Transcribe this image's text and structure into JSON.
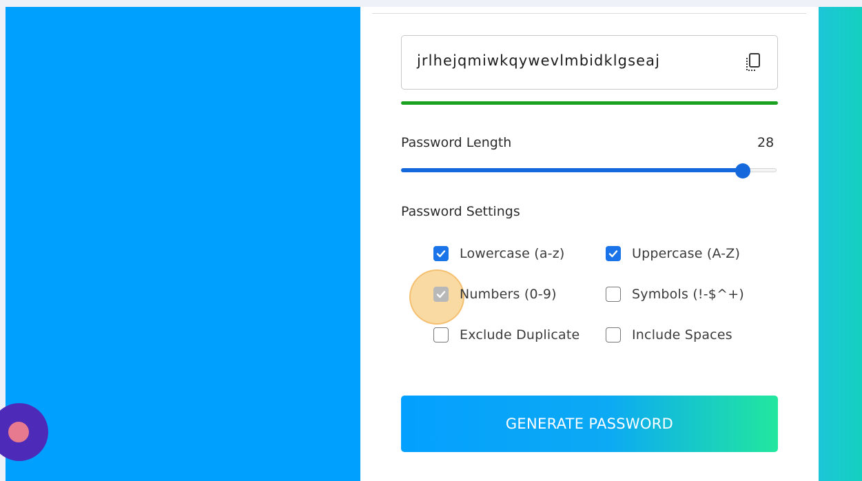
{
  "password_field": {
    "value": "jrlhejqmiwkqywevlmbidklgseaj",
    "copy_icon": "copy-icon"
  },
  "strength": {
    "color": "#19a11f"
  },
  "length": {
    "label": "Password Length",
    "value": "28",
    "slider_level": 0.91
  },
  "settings": {
    "title": "Password Settings",
    "options": [
      {
        "label": "Lowercase (a-z)",
        "checked": true
      },
      {
        "label": "Uppercase (A-Z)",
        "checked": true
      },
      {
        "label": "Numbers (0-9)",
        "checked": true
      },
      {
        "label": "Symbols (!-$^+)",
        "checked": false
      },
      {
        "label": "Exclude Duplicate",
        "checked": false
      },
      {
        "label": "Include Spaces",
        "checked": false
      }
    ]
  },
  "generate_button": {
    "label": "GENERATE PASSWORD"
  },
  "colors": {
    "accent_blue": "#1468dc",
    "left_panel": "#00a0ff",
    "right_panel": "#14d0bf",
    "button_gradient_end": "#22e79e"
  }
}
